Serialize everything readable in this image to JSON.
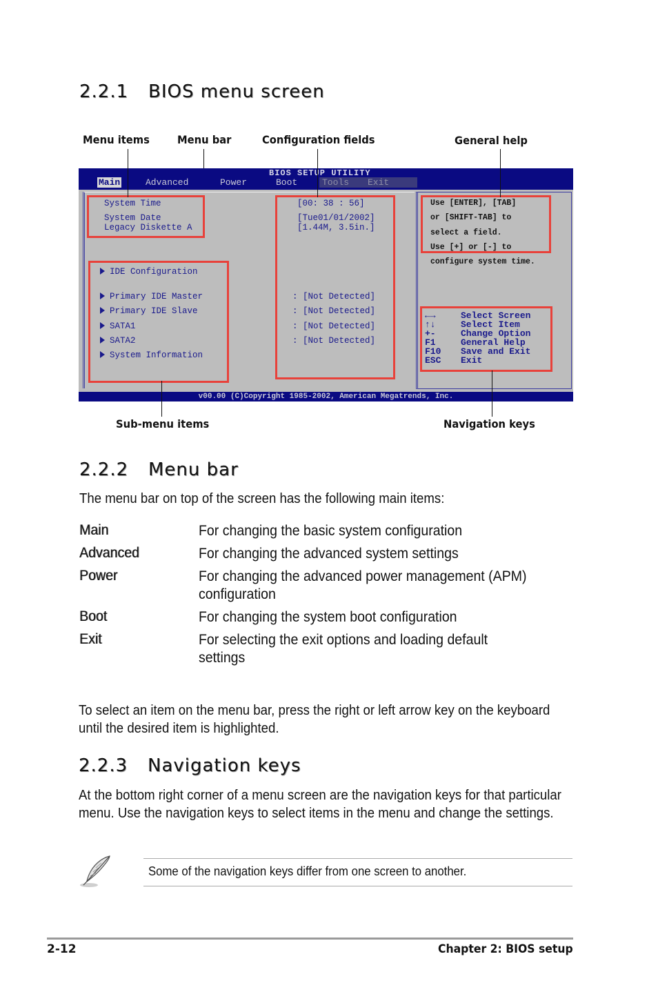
{
  "section1": {
    "number": "2.2.1",
    "title": "BIOS menu screen",
    "callouts": {
      "menu_items": "Menu items",
      "menu_bar": "Menu bar",
      "configuration_fields": "Configuration fields",
      "general_help": "General help",
      "sub_menu_items": "Sub-menu items",
      "navigation_keys": "Navigation keys"
    },
    "bios": {
      "title": "BIOS SETUP UTILITY",
      "menu": [
        "Main",
        "Advanced",
        "Power",
        "Boot",
        "Tools",
        "Exit"
      ],
      "active_menu": "Main",
      "items": [
        {
          "label": "System Time",
          "value": "[00: 38 : 56]"
        },
        {
          "label": "System Date",
          "value": "[Tue01/01/2002]"
        },
        {
          "label": "Legacy Diskette A",
          "value": "[1.44M, 3.5in.]"
        }
      ],
      "submenus": [
        {
          "label": "IDE Configuration",
          "value": ""
        },
        {
          "label": "Primary IDE Master",
          "value": ": [Not Detected]"
        },
        {
          "label": "Primary IDE Slave",
          "value": ": [Not Detected]"
        },
        {
          "label": "SATA1",
          "value": ": [Not Detected]"
        },
        {
          "label": "SATA2",
          "value": ": [Not Detected]"
        },
        {
          "label": "System Information",
          "value": ""
        }
      ],
      "help_lines": [
        "Use [ENTER], [TAB]",
        "or [SHIFT-TAB] to",
        "select a field.",
        "Use [+] or [-] to",
        "configure system time."
      ],
      "nav_keys": [
        {
          "key": "←→",
          "action": "Select Screen"
        },
        {
          "key": "↑↓",
          "action": "Select Item"
        },
        {
          "key": "+-",
          "action": "Change Option"
        },
        {
          "key": "F1",
          "action": "General Help"
        },
        {
          "key": "F10",
          "action": "Save and Exit"
        },
        {
          "key": "ESC",
          "action": "Exit"
        }
      ],
      "copyright": "v00.00 (C)Copyright 1985-2002, American Megatrends, Inc."
    }
  },
  "section2": {
    "number": "2.2.2",
    "title": "Menu bar",
    "intro": "The menu bar on top of the screen has the following main items:",
    "items": [
      {
        "term": "Main",
        "definition": "For changing the basic system configuration"
      },
      {
        "term": "Advanced",
        "definition": "For changing the advanced system settings"
      },
      {
        "term": "Power",
        "definition": "For changing the advanced power management (APM) configuration"
      },
      {
        "term": "Boot",
        "definition": "For changing the system boot configuration"
      },
      {
        "term": "Exit",
        "definition": "For selecting the exit options and loading default settings"
      }
    ],
    "outro": "To select an item on the menu bar, press the right or left arrow key on the keyboard until the desired item is highlighted."
  },
  "section3": {
    "number": "2.2.3",
    "title": "Navigation keys",
    "body": "At the bottom right corner of a menu screen are the navigation keys for that particular menu. Use the navigation keys to select items in the menu and change the settings.",
    "note_icon": "feather-pen-icon",
    "note": "Some of the navigation keys differ from one screen to another."
  },
  "footer": {
    "page": "2-12",
    "chapter": "Chapter 2: BIOS setup"
  },
  "colors": {
    "bios_blue": "#0a0a82",
    "bios_gray": "#bdbdbd",
    "bios_text": "#1a1a8c",
    "callout_red": "#e8413a"
  }
}
